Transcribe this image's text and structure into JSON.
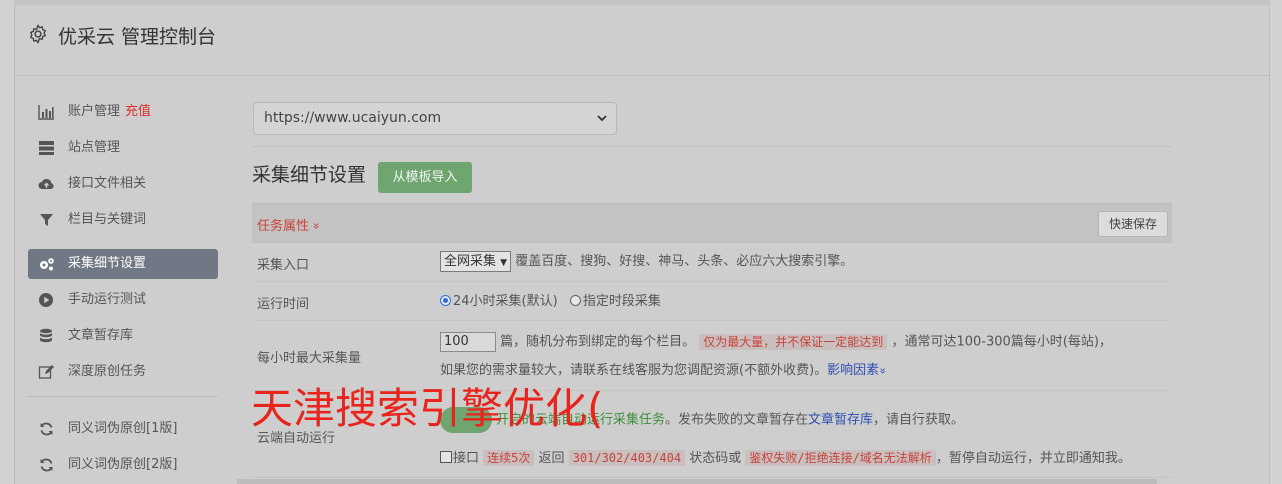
{
  "header": {
    "title": "优采云 管理控制台",
    "icon": "gear-icon"
  },
  "sidebar": {
    "items": [
      {
        "label": "账户管理",
        "extra": "充值",
        "icon": "bar-chart-icon"
      },
      {
        "label": "站点管理",
        "icon": "server-icon"
      },
      {
        "label": "接口文件相关",
        "icon": "cloud-upload-icon"
      },
      {
        "label": "栏目与关键词",
        "icon": "filter-icon"
      },
      {
        "label": "采集细节设置",
        "icon": "cogs-icon",
        "active": true
      },
      {
        "label": "手动运行测试",
        "icon": "play-circle-icon"
      },
      {
        "label": "文章暂存库",
        "icon": "database-icon"
      },
      {
        "label": "深度原创任务",
        "icon": "edit-icon"
      },
      {
        "label": "同义词伪原创[1版]",
        "icon": "refresh-icon"
      },
      {
        "label": "同义词伪原创[2版]",
        "icon": "refresh-icon"
      }
    ]
  },
  "site_select": {
    "value": "https://www.ucaiyun.com"
  },
  "section": {
    "title": "采集细节设置",
    "import_button": "从模板导入"
  },
  "table": {
    "header": {
      "prop_label": "任务属性",
      "prop_chevron": "»",
      "quick_save": "快速保存"
    },
    "rows": {
      "entry": {
        "name": "采集入口",
        "select_value": "全网采集",
        "desc": "覆盖百度、搜狗、好搜、神马、头条、必应六大搜索引擎。"
      },
      "runtime": {
        "name": "运行时间",
        "option1": "24小时采集(默认)",
        "option2": "指定时段采集"
      },
      "max_per_hour": {
        "name": "每小时最大采集量",
        "value": "100",
        "text1": "篇，随机分布到绑定的每个栏目。",
        "warn": "仅为最大量，并不保证一定能达到",
        "text2": "，通常可达100-300篇每小时(每站)，",
        "text3": "如果您的需求量较大，请联系在线客服为您调配资源(不额外收费)。",
        "link": "影响因素",
        "link_chevron": "»"
      },
      "cloud": {
        "name": "云端自动运行",
        "line1_a": "开启的云端自动运行采集任务",
        "line1_b": "。发布失败的文章暂存在",
        "line1_link": "文章暂存库",
        "line1_c": "，请自行获取。",
        "line2_a": "接口",
        "line2_tag1": "连续5次",
        "line2_b": "返回",
        "line2_tag2": "301/302/403/404",
        "line2_c": "状态码或",
        "line2_tag3": "鉴权失败/拒绝连接/域名无法解析",
        "line2_d": "，暂停自动运行，并立即通知我。"
      }
    }
  },
  "watermark": "天津搜索引擎优化(",
  "colors": {
    "accent_green": "#6fa56f",
    "active_nav": "#707886",
    "warn_red": "#c9433b"
  }
}
